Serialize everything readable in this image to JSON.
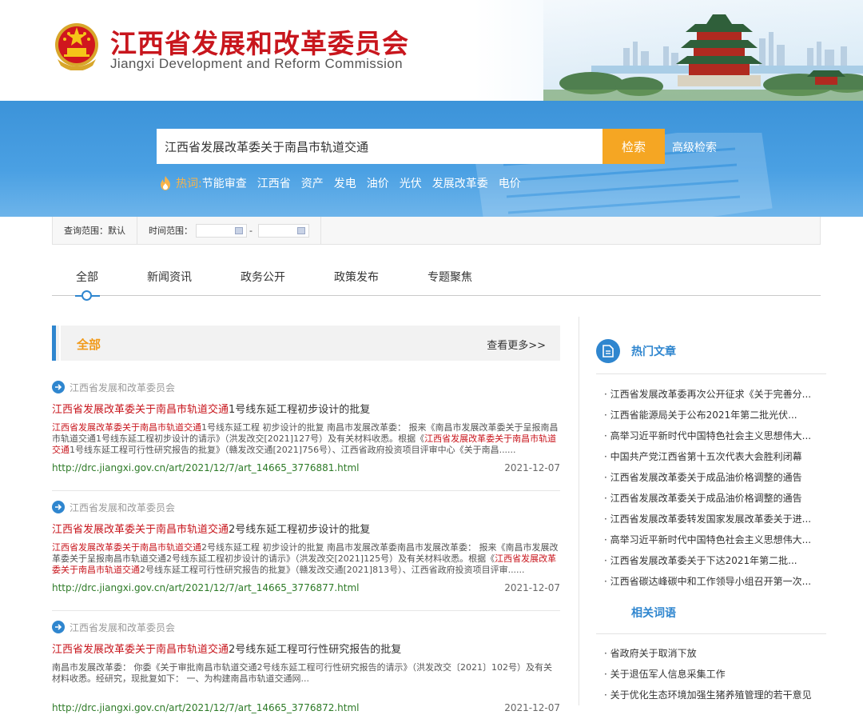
{
  "header": {
    "title": "江西省发展和改革委员会",
    "subtitle": "Jiangxi Development and Reform Commission"
  },
  "search": {
    "query": "江西省发展改革委关于南昌市轨道交通",
    "button_label": "检索",
    "advanced_label": "高级检索",
    "hot_label": "热词:",
    "hot_words": [
      "节能审查",
      "江西省",
      "资产",
      "发电",
      "油价",
      "光伏",
      "发展改革委",
      "电价"
    ]
  },
  "filter": {
    "scope_label": "查询范围：默认",
    "time_label": "时间范围：",
    "dash": "-"
  },
  "tabs": [
    "全部",
    "新闻资讯",
    "政务公开",
    "政策发布",
    "专题聚焦"
  ],
  "results_section": {
    "title": "全部",
    "more_label": "查看更多>>"
  },
  "results": [
    {
      "source": "江西省发展和改革委员会",
      "title_hl": "江西省发展改革委关于南昌市轨道交通",
      "title_rest": "1号线东延工程初步设计的批复",
      "snippet": [
        {
          "hl": true,
          "t": "江西省发展改革委关于南昌市轨道交通"
        },
        {
          "hl": false,
          "t": "1号线东延工程 初步设计的批复 南昌市发展改革委： 报来《南昌市发展改革委关于呈报南昌市轨道交通1号线东延工程初步设计的请示》（洪发改交[2021]127号）及有关材料收悉。根据《"
        },
        {
          "hl": true,
          "t": "江西省发展改革委关于南昌市轨道交通"
        },
        {
          "hl": false,
          "t": "1号线东延工程可行性研究报告的批复》（赣发改交通[2021]756号）、江西省政府投资项目评审中心《关于南昌......"
        }
      ],
      "url": "http://drc.jiangxi.gov.cn/art/2021/12/7/art_14665_3776881.html",
      "date": "2021-12-07"
    },
    {
      "source": "江西省发展和改革委员会",
      "title_hl": "江西省发展改革委关于南昌市轨道交通",
      "title_rest": "2号线东延工程初步设计的批复",
      "snippet": [
        {
          "hl": true,
          "t": "江西省发展改革委关于南昌市轨道交通"
        },
        {
          "hl": false,
          "t": "2号线东延工程 初步设计的批复 南昌市发展改革委南昌市发展改革委： 报来《南昌市发展改革委关于呈报南昌市轨道交通2号线东延工程初步设计的请示》（洪发改交[2021]125号）及有关材料收悉。根据《"
        },
        {
          "hl": true,
          "t": "江西省发展改革委关于南昌市轨道交通"
        },
        {
          "hl": false,
          "t": "2号线东延工程可行性研究报告的批复》（赣发改交通[2021]813号）、江西省政府投资项目评审......"
        }
      ],
      "url": "http://drc.jiangxi.gov.cn/art/2021/12/7/art_14665_3776877.html",
      "date": "2021-12-07"
    },
    {
      "source": "江西省发展和改革委员会",
      "title_hl": "江西省发展改革委关于南昌市轨道交通",
      "title_rest": "2号线东延工程可行性研究报告的批复",
      "snippet": [
        {
          "hl": false,
          "t": "南昌市发展改革委： 你委《关于审批南昌市轨道交通2号线东延工程可行性研究报告的请示》（洪发改交〔2021〕102号）及有关材料收悉。经研究，现批复如下： 一、为构建南昌市轨道交通网..."
        }
      ],
      "url": "http://drc.jiangxi.gov.cn/art/2021/12/7/art_14665_3776872.html",
      "date": "2021-12-07"
    }
  ],
  "hot_articles": {
    "title": "热门文章",
    "items": [
      "· 江西省发展改革委再次公开征求《关于完善分...",
      "· 江西省能源局关于公布2021年第二批光伏...",
      "· 高举习近平新时代中国特色社会主义思想伟大...",
      "· 中国共产党江西省第十五次代表大会胜利闭幕",
      "· 江西省发展改革委关于成品油价格调整的通告",
      "· 江西省发展改革委关于成品油价格调整的通告",
      "· 江西省发展改革委转发国家发展改革委关于进...",
      "· 高举习近平新时代中国特色社会主义思想伟大...",
      "· 江西省发展改革委关于下达2021年第二批...",
      "· 江西省碳达峰碳中和工作领导小组召开第一次..."
    ]
  },
  "related_terms": {
    "title": "相关词语",
    "items": [
      "· 省政府关于取消下放",
      "· 关于退伍军人信息采集工作",
      "· 关于优化生态环境加强生猪养殖管理的若干意见"
    ]
  },
  "colors": {
    "brand_red": "#c8161d",
    "band_blue": "#4aa0e3",
    "accent_orange": "#f5a623",
    "link_green": "#2d7a27",
    "tab_blue": "#2f86cf"
  }
}
